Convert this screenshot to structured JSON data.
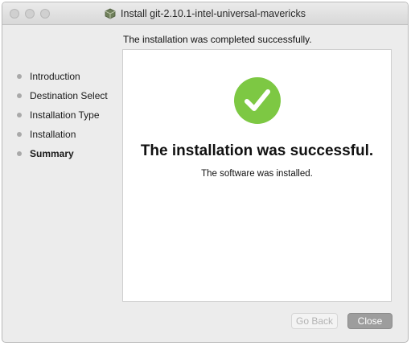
{
  "window": {
    "title": "Install git-2.10.1-intel-universal-mavericks"
  },
  "header": {
    "subtitle": "The installation was completed successfully."
  },
  "sidebar": {
    "steps": [
      {
        "label": "Introduction",
        "current": false
      },
      {
        "label": "Destination Select",
        "current": false
      },
      {
        "label": "Installation Type",
        "current": false
      },
      {
        "label": "Installation",
        "current": false
      },
      {
        "label": "Summary",
        "current": true
      }
    ]
  },
  "main": {
    "headline": "The installation was successful.",
    "detail": "The software was installed.",
    "status_icon": "checkmark-success-icon",
    "success_color": "#7dc843"
  },
  "footer": {
    "back_label": "Go Back",
    "back_enabled": false,
    "close_label": "Close"
  }
}
